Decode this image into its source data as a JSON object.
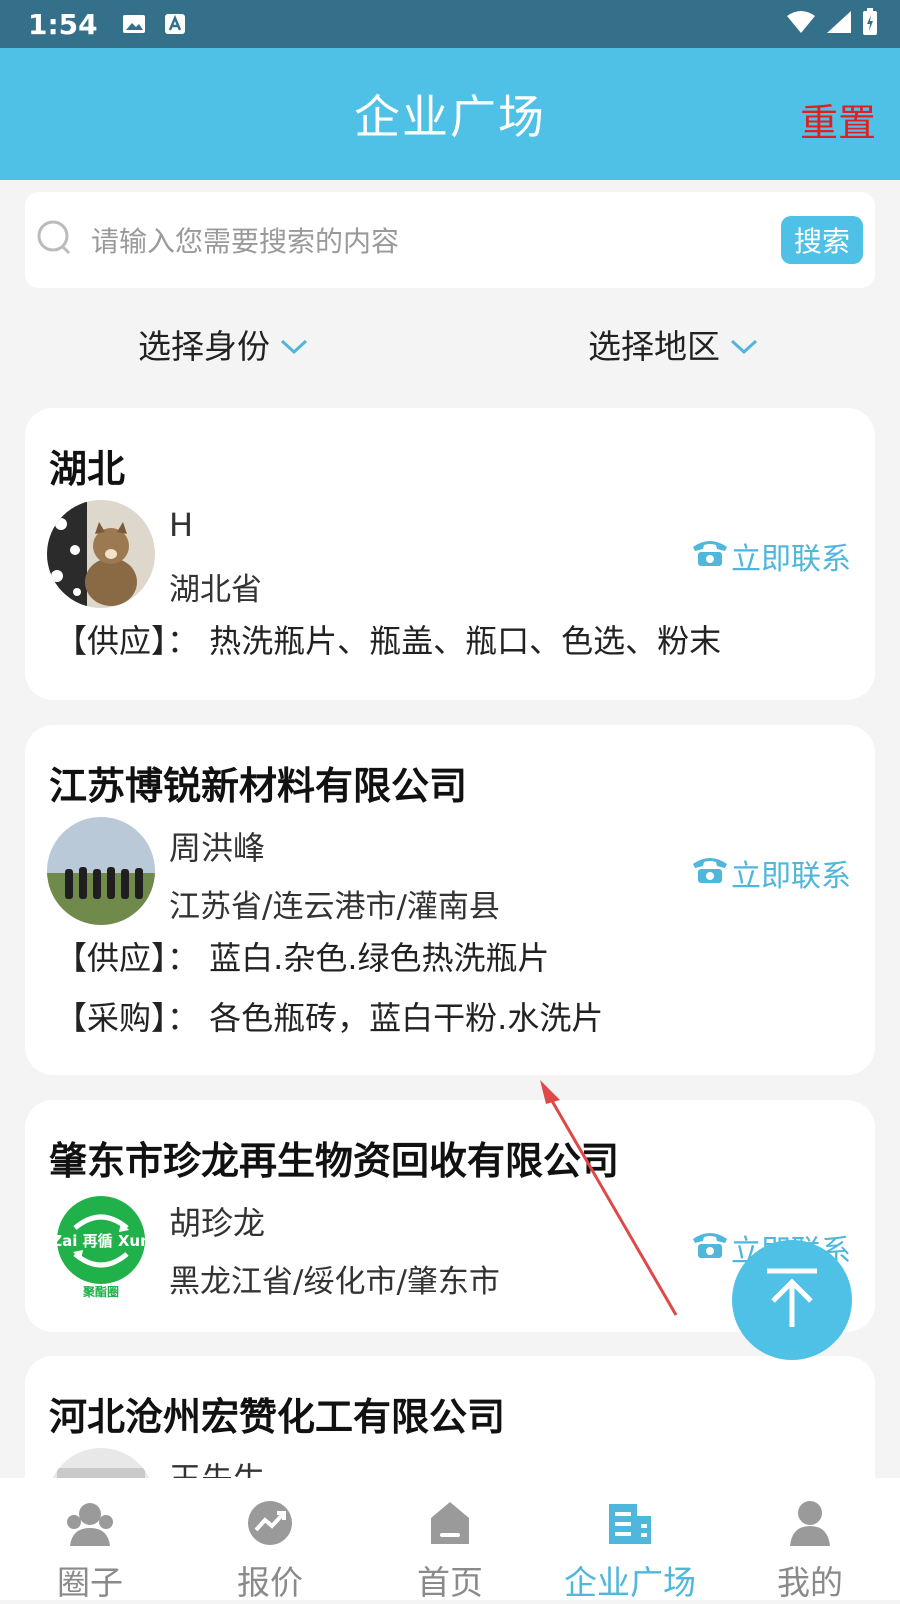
{
  "status_bar": {
    "time": "1:54"
  },
  "header": {
    "title": "企业广场",
    "reset_label": "重置"
  },
  "search": {
    "placeholder": "请输入您需要搜索的内容",
    "button_label": "搜索"
  },
  "filters": [
    {
      "label": "选择身份"
    },
    {
      "label": "选择地区"
    }
  ],
  "cards": [
    {
      "name": "湖北",
      "person": "H",
      "region": "湖北省",
      "contact_label": "立即联系",
      "lines": [
        "【供应】： 热洗瓶片、瓶盖、瓶口、色选、粉末"
      ]
    },
    {
      "name": "江苏博锐新材料有限公司",
      "person": "周洪峰",
      "region": "江苏省/连云港市/灌南县",
      "contact_label": "立即联系",
      "lines": [
        "【供应】： 蓝白.杂色.绿色热洗瓶片",
        "【采购】： 各色瓶砖，蓝白干粉.水洗片"
      ]
    },
    {
      "name": "肇东市珍龙再生物资回收有限公司",
      "person": "胡珍龙",
      "region": "黑龙江省/绥化市/肇东市",
      "contact_label": "立即联系",
      "lines": [],
      "logo_text": {
        "top": "Zai 再循 Xun",
        "bottom": "聚酯圈"
      }
    },
    {
      "name": "河北沧州宏赞化工有限公司",
      "person": "王先生",
      "region": "",
      "contact_label": "",
      "lines": []
    }
  ],
  "tabbar": [
    {
      "label": "圈子",
      "icon": "people-icon",
      "active": false
    },
    {
      "label": "报价",
      "icon": "trend-icon",
      "active": false
    },
    {
      "label": "首页",
      "icon": "home-icon",
      "active": false
    },
    {
      "label": "企业广场",
      "icon": "building-icon",
      "active": true
    },
    {
      "label": "我的",
      "icon": "user-icon",
      "active": false
    }
  ],
  "colors": {
    "accent": "#4fc0e6",
    "status_bar": "#35708a",
    "reset": "#e02020",
    "annotation_arrow": "#e04848"
  }
}
